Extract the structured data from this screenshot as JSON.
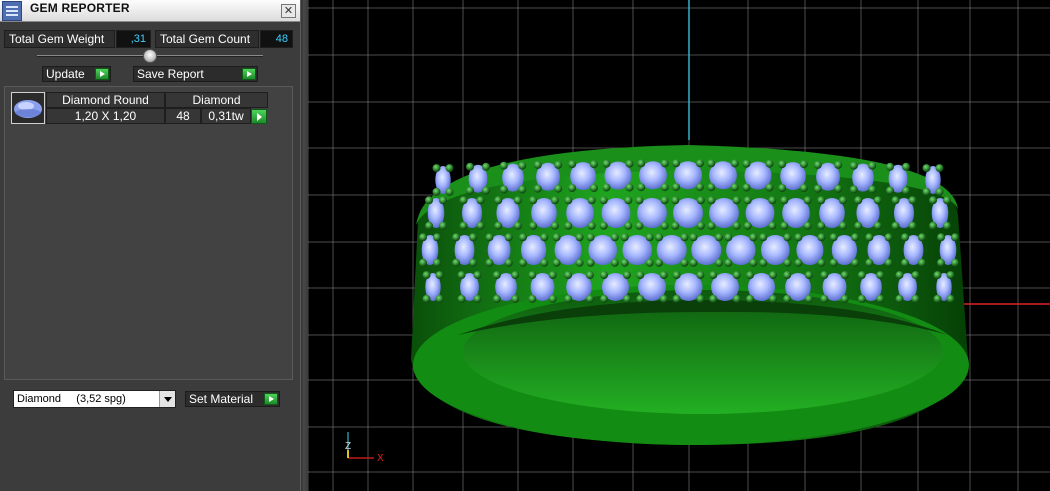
{
  "window": {
    "title": "GEM REPORTER",
    "close_glyph": "✕"
  },
  "stats": {
    "total_weight_label": "Total Gem Weight",
    "total_weight_value": ",31",
    "total_count_label": "Total Gem Count",
    "total_count_value": "48"
  },
  "buttons": {
    "update": "Update",
    "save_report": "Save Report",
    "set_material": "Set Material"
  },
  "gem_list": {
    "headers": [
      "Diamond Round",
      "Diamond"
    ],
    "rows": [
      {
        "size": "1,20 X 1,20",
        "count": "48",
        "weight": "0,31tw"
      }
    ]
  },
  "material_select": {
    "value": "Diamond     (3,52 spg)"
  },
  "viewport": {
    "axis_labels": {
      "x": "X",
      "z": "Z"
    },
    "colors": {
      "ring": "#1e8a1e",
      "gem": "#a8b8ff",
      "grid": "#8a8a8a",
      "axis_x": "#e02020",
      "axis_y": "#2fb4c8"
    }
  }
}
